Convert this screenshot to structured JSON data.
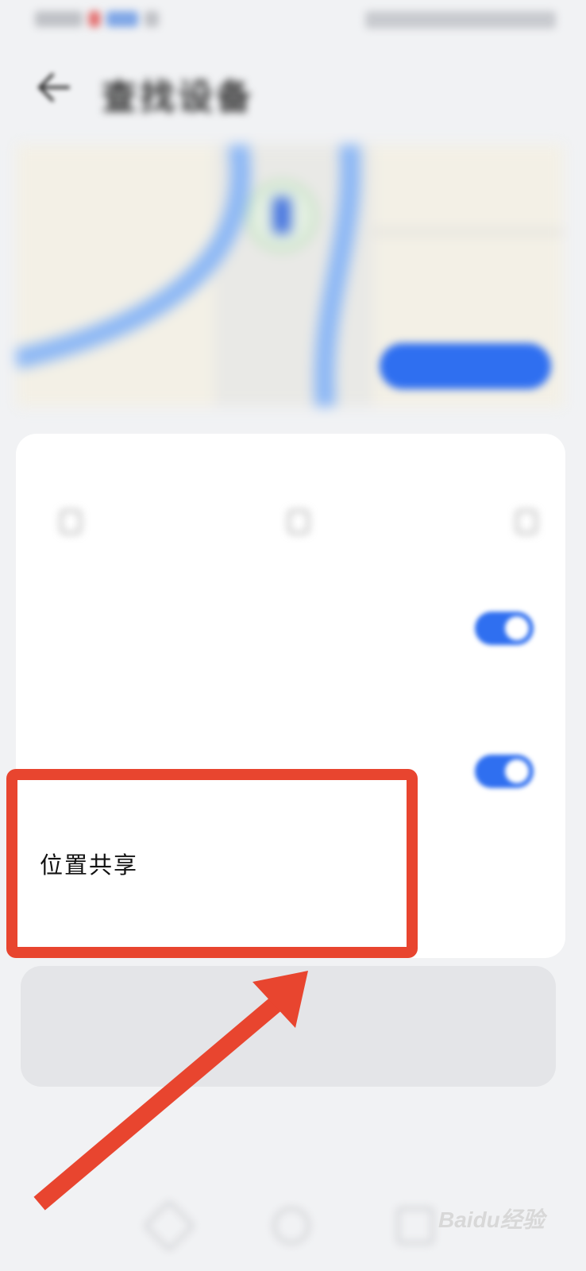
{
  "status_bar": {
    "left": "",
    "right": ""
  },
  "header": {
    "title": "查找设备"
  },
  "map": {
    "find_button_label": ""
  },
  "card": {
    "headline": "",
    "features": [
      {
        "label": ""
      },
      {
        "label": ""
      },
      {
        "label": ""
      }
    ],
    "settings": [
      {
        "title": "",
        "description": "",
        "link": "",
        "enabled": true
      },
      {
        "title": "",
        "description": "",
        "enabled": true
      }
    ],
    "location_sharing": {
      "title": "位置共享",
      "subtitle": "",
      "value": ""
    }
  },
  "info_card": {
    "line1": "",
    "line2": ""
  },
  "bottom_link": "",
  "watermark": "Baidu经验",
  "colors": {
    "accent": "#2f6ff0",
    "annotation": "#e8452f",
    "background": "#f1f2f4"
  }
}
